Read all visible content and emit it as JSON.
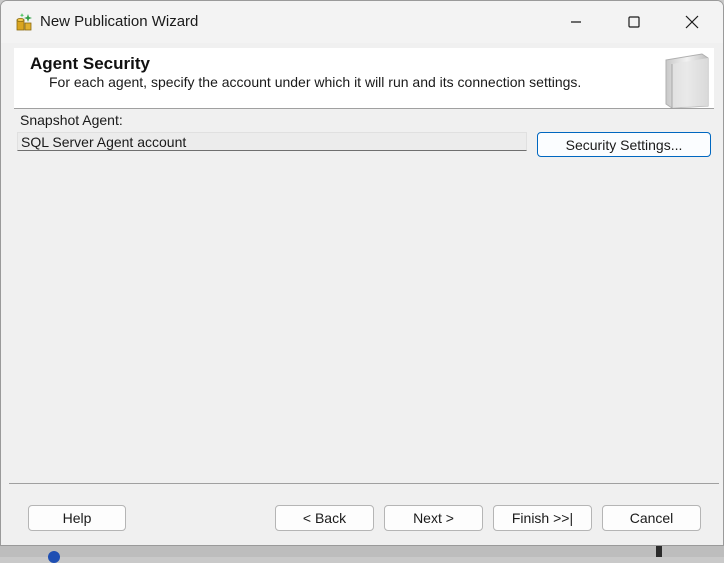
{
  "window": {
    "title": "New Publication Wizard",
    "controls": {
      "minimize": "minimize",
      "maximize": "maximize",
      "close": "close"
    }
  },
  "header": {
    "title": "Agent Security",
    "subtitle": "For each agent, specify the account under which it will run and its connection settings."
  },
  "snapshot_agent": {
    "label": "Snapshot Agent:",
    "account": "SQL Server Agent account",
    "security_button": "Security Settings..."
  },
  "footer": {
    "help": "Help",
    "back": "< Back",
    "next": "Next >",
    "finish": "Finish >>|",
    "cancel": "Cancel"
  },
  "colors": {
    "accent_border": "#0067c0",
    "window_bg": "#f0f0f0",
    "header_bg": "#ffffff"
  },
  "icons": [
    "publication-wizard-icon",
    "minimize-icon",
    "maximize-icon",
    "close-icon",
    "wizard-page-art"
  ]
}
